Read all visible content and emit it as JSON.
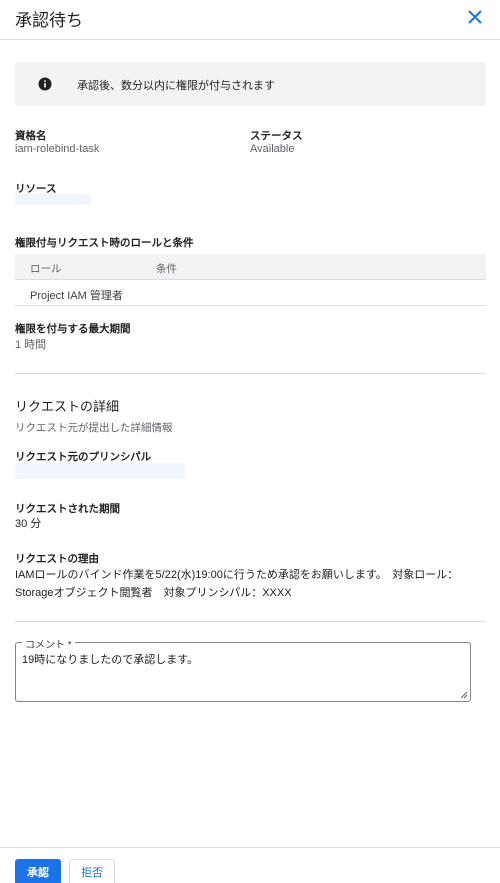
{
  "header": {
    "title": "承認待ち",
    "close_icon": "close-icon"
  },
  "info": {
    "icon": "info-icon",
    "text": "承認後、数分以内に権限が付与されます"
  },
  "entitlement": {
    "label": "資格名",
    "value": "iam-rolebind-task"
  },
  "status": {
    "label": "ステータス",
    "value": "Available"
  },
  "resource": {
    "label": "リソース"
  },
  "roles": {
    "label": "権限付与リクエスト時のロールと条件",
    "headers": [
      "ロール",
      "条件"
    ],
    "rows": [
      {
        "role": "Project IAM 管理者",
        "condition": ""
      }
    ]
  },
  "max_duration": {
    "label": "権限を付与する最大期間",
    "value": "1 時間"
  },
  "request": {
    "title": "リクエストの詳細",
    "subtitle": "リクエスト元が提出した詳細情報",
    "principal_label": "リクエスト元のプリンシパル",
    "duration_label": "リクエストされた期間",
    "duration_value": "30 分",
    "reason_label": "リクエストの理由",
    "reason_value": "IAMロールのバインド作業を5/22(水)19:00に行うため承認をお願いします。　対象ロール：Storageオブジェクト閲覧者　対象プリンシパル：XXXX"
  },
  "comment": {
    "label": "コメント *",
    "value": "19時になりましたので承認します。"
  },
  "footer": {
    "approve": "承認",
    "reject": "拒否"
  },
  "colors": {
    "accent": "#1a73e8",
    "panel": "#f1f3f4",
    "divider": "#dadce0"
  }
}
